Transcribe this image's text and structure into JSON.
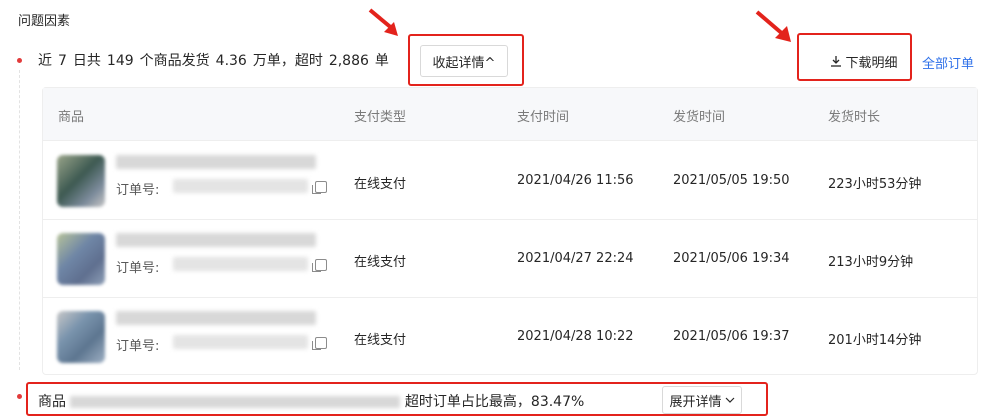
{
  "section_title": "问题因素",
  "summary": {
    "text_a": "近",
    "days": "7",
    "text_b": "日共",
    "products": "149",
    "text_c": "个商品发货",
    "shipped": "4.36",
    "text_d": "万单，超时",
    "overdue": "2,886",
    "text_e": "单"
  },
  "collapse_button": "收起详情^",
  "download_button": "下载明细",
  "all_orders_link": "全部订单",
  "table": {
    "headers": [
      "商品",
      "支付类型",
      "支付时间",
      "发货时间",
      "发货时长"
    ],
    "order_label": "订单号:",
    "rows": [
      {
        "pay_type": "在线支付",
        "pay_time": "2021/04/26 11:56",
        "ship_time": "2021/05/05 19:50",
        "duration": "223小时53分钟"
      },
      {
        "pay_type": "在线支付",
        "pay_time": "2021/04/27 22:24",
        "ship_time": "2021/05/06 19:34",
        "duration": "213小时9分钟"
      },
      {
        "pay_type": "在线支付",
        "pay_time": "2021/04/28 10:22",
        "ship_time": "2021/05/06 19:37",
        "duration": "201小时14分钟"
      }
    ]
  },
  "bottom_row": {
    "prefix": "商品",
    "stat": "超时订单占比最高，83.47%",
    "expand_button": "展开详情"
  },
  "colors": {
    "accent_red": "#e3231c",
    "link_blue": "#2f71e9"
  },
  "icons": [
    "download-icon",
    "copy-icon",
    "chevron-up-icon",
    "chevron-down-icon",
    "annotation-arrow-icon"
  ]
}
